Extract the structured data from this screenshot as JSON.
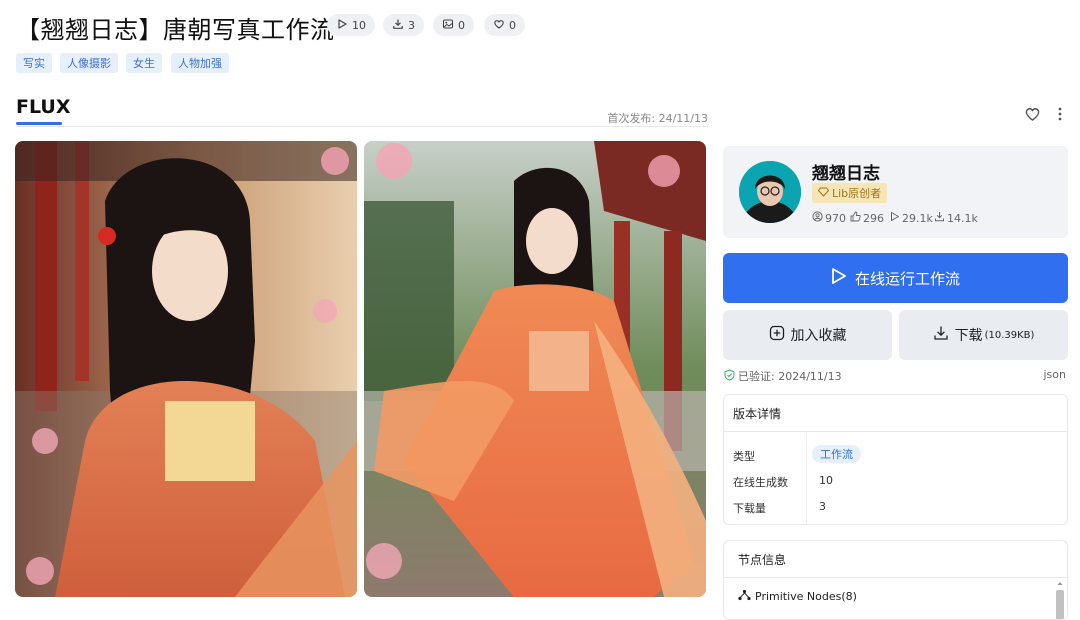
{
  "header": {
    "title": "【翘翘日志】唐朝写真工作流",
    "stats": [
      {
        "icon": "play-icon",
        "value": "10"
      },
      {
        "icon": "download-icon",
        "value": "3"
      },
      {
        "icon": "image-icon",
        "value": "0"
      },
      {
        "icon": "heart-icon",
        "value": "0"
      }
    ],
    "tags": [
      "写实",
      "人像摄影",
      "女生",
      "人物加强"
    ]
  },
  "model_tab": {
    "label": "FLUX",
    "publish_date": "首次发布: 24/11/13"
  },
  "author": {
    "name": "翘翘日志",
    "badge": "Lib原创者",
    "stats": [
      {
        "icon": "user-icon",
        "value": "970"
      },
      {
        "icon": "like-icon",
        "value": "296"
      },
      {
        "icon": "play-icon",
        "value": "29.1k"
      },
      {
        "icon": "download-icon",
        "value": "14.1k"
      }
    ]
  },
  "actions": {
    "run_label": "在线运行工作流",
    "collect_label": "加入收藏",
    "download_label": "下载",
    "download_size": "(10.39KB)"
  },
  "verified": {
    "text": "已验证: 2024/11/13",
    "json_link": "json"
  },
  "version_details": {
    "title": "版本详情",
    "rows": [
      {
        "label": "类型",
        "value": "工作流"
      },
      {
        "label": "在线生成数",
        "value": "10"
      },
      {
        "label": "下载量",
        "value": "3"
      }
    ]
  },
  "node_info": {
    "title": "节点信息",
    "items": [
      "Primitive Nodes(8)"
    ]
  },
  "colors": {
    "accent": "#2f6ff0",
    "tag_bg": "#e6effc",
    "badge_bg": "#f6e5b7"
  }
}
